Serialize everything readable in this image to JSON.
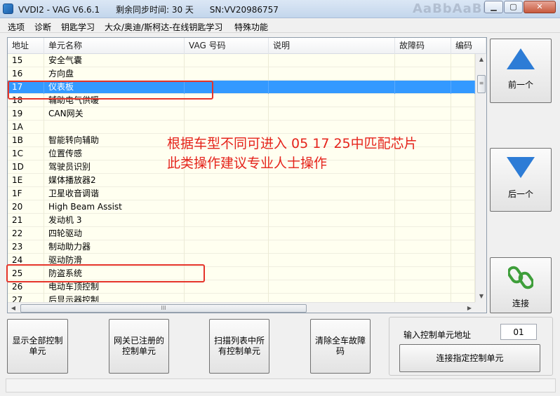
{
  "window": {
    "title": "VVDI2 - VAG V6.6.1      剩余同步时间: 30 天      SN:VV20986757",
    "ghost_text": "AaBbAaBb",
    "min_icon": "minimize-icon",
    "max_icon": "maximize-icon",
    "close_icon": "close-icon",
    "close_glyph": "✕"
  },
  "menu": [
    "选项",
    "诊断",
    "钥匙学习",
    "大众/奥迪/斯柯达-在线钥匙学习",
    "特殊功能"
  ],
  "list": {
    "columns": [
      "地址",
      "单元名称",
      "VAG 号码",
      "说明",
      "故障码",
      "编码"
    ],
    "rows": [
      {
        "addr": "15",
        "name": "安全气囊"
      },
      {
        "addr": "16",
        "name": "方向盘"
      },
      {
        "addr": "17",
        "name": "仪表板"
      },
      {
        "addr": "18",
        "name": "辅助电气供暖"
      },
      {
        "addr": "19",
        "name": "CAN网关"
      },
      {
        "addr": "1A",
        "name": ""
      },
      {
        "addr": "1B",
        "name": "智能转向辅助"
      },
      {
        "addr": "1C",
        "name": "位置传感"
      },
      {
        "addr": "1D",
        "name": "驾驶员识别"
      },
      {
        "addr": "1E",
        "name": "媒体播放器2"
      },
      {
        "addr": "1F",
        "name": "卫星收音调谐"
      },
      {
        "addr": "20",
        "name": "High Beam Assist"
      },
      {
        "addr": "21",
        "name": "发动机 3"
      },
      {
        "addr": "22",
        "name": "四轮驱动"
      },
      {
        "addr": "23",
        "name": "制动助力器"
      },
      {
        "addr": "24",
        "name": "驱动防滑"
      },
      {
        "addr": "25",
        "name": "防盗系统"
      },
      {
        "addr": "26",
        "name": "电动车顶控制"
      },
      {
        "addr": "27",
        "name": "后显示器控制"
      }
    ],
    "selected_addr": "17",
    "highlighted_addrs": [
      "17",
      "25"
    ],
    "scroll_grip": "≡",
    "hscroll_grip": "III",
    "arrow_up": "▲",
    "arrow_down": "▼",
    "arrow_left": "◀",
    "arrow_right": "▶"
  },
  "annotation": {
    "line1": "根据车型不同可进入 05 17 25中匹配芯片",
    "line2": "此类操作建议专业人士操作",
    "color": "#e5231b"
  },
  "side_buttons": {
    "prev": {
      "label": "前一个",
      "icon": "arrow-up-icon"
    },
    "next": {
      "label": "后一个",
      "icon": "arrow-down-icon"
    },
    "connect": {
      "label": "连接",
      "icon": "chain-link-icon"
    }
  },
  "actions": {
    "show_all": "显示全部控制单元",
    "gateway_registered": "网关已注册的控制单元",
    "scan_all": "扫描列表中所有控制单元",
    "clear_dtc": "清除全车故障码"
  },
  "connect_panel": {
    "label": "输入控制单元地址",
    "address_value": "01",
    "button": "连接指定控制单元"
  },
  "status": {
    "text": ""
  },
  "colors": {
    "selection": "#3399ff",
    "list_background": "#fffff0",
    "highlight_box": "#e5342a",
    "arrow": "#2d7cd6",
    "chain": "#3e9e3a"
  }
}
